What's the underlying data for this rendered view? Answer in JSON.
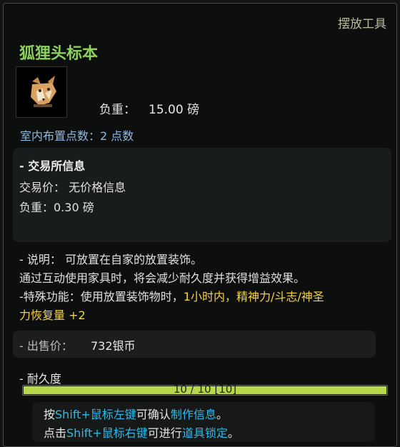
{
  "header": {
    "category": "摆放工具",
    "title": "狐狸头标本"
  },
  "icon": "fox-head-specimen-icon",
  "stats": {
    "weight_label": "负重：",
    "weight_value": "15.00 磅"
  },
  "decoration": "室内布置点数：2 点数",
  "trade": {
    "heading": "- 交易所信息",
    "price_line": "交易价： 无价格信息",
    "weight_line": "负重：0.30 磅"
  },
  "description": {
    "line1": "- 说明： 可放置在自家的放置装饰。",
    "line2": "通过互动使用家具时，将会减少耐久度并获得增益效果。",
    "line3_prefix": "-特殊功能：使用放置装饰物时，",
    "line3_highlight": "1小时内，精神力/斗志/神圣",
    "line4_highlight": "力恢复量 +2"
  },
  "sell": {
    "label": "- 出售价：",
    "value": "732银币"
  },
  "durability": {
    "label": "- 耐久度",
    "text": "10 / 10  [10]",
    "fraction": 1.0
  },
  "hints": {
    "line1": {
      "a": "按",
      "b": "Shift+鼠标左键",
      "c": "可确认",
      "d": "制作信息",
      "e": "。"
    },
    "line2": {
      "a": "点击",
      "b": "Shift+鼠标右键",
      "c": "可进行",
      "d": "道具锁定",
      "e": "。"
    }
  },
  "colors": {
    "title": "#8bd05f",
    "highlight": "#f4d14a",
    "link": "#2fb9e8",
    "durability_bar": "#b6d84a"
  }
}
